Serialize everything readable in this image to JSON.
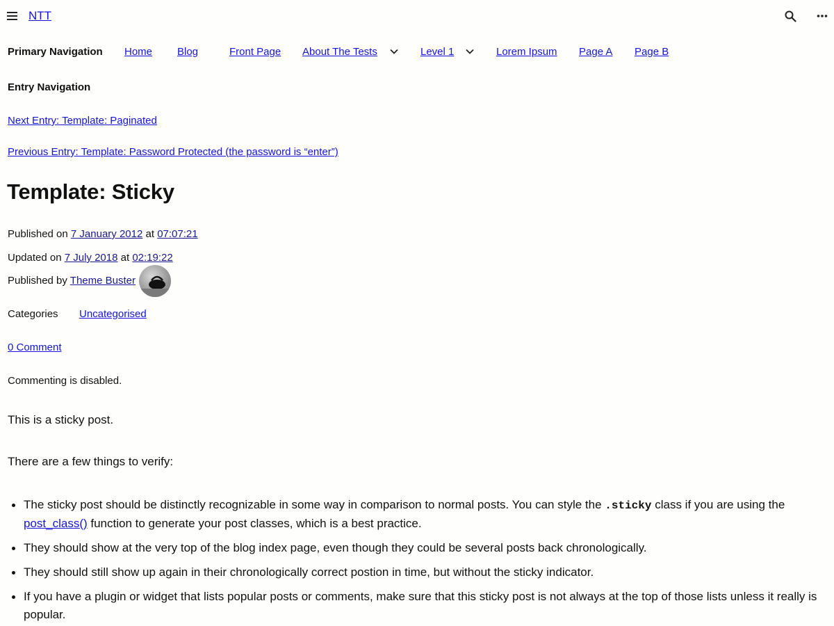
{
  "header": {
    "site_title": "NTT",
    "icons": [
      "menu-icon",
      "search-icon",
      "more-icon"
    ]
  },
  "primary_nav": {
    "heading": "Primary Navigation",
    "items": [
      {
        "label": "Home"
      },
      {
        "label": "Blog"
      },
      {
        "label": "Front Page"
      },
      {
        "label": "About The Tests",
        "has_submenu": true
      },
      {
        "label": "Level 1",
        "has_submenu": true
      },
      {
        "label": "Lorem Ipsum"
      },
      {
        "label": "Page A"
      },
      {
        "label": "Page B"
      }
    ]
  },
  "entry_nav": {
    "heading": "Entry Navigation",
    "next": "Next Entry: Template: Paginated",
    "previous": "Previous Entry: Template: Password Protected (the password is “enter”)"
  },
  "post": {
    "title": "Template: Sticky",
    "published": {
      "prefix": "Published on ",
      "date": "7 January 2012",
      "at": " at ",
      "time": "07:07:21"
    },
    "updated": {
      "prefix": "Updated on ",
      "date": "7 July 2018",
      "at": " at ",
      "time": "02:19:22"
    },
    "author": {
      "prefix": "Published by ",
      "name": "Theme Buster"
    },
    "categories_label": "Categories",
    "category": "Uncategorised",
    "comments_link": "0 Comment",
    "comment_status": "Commenting is disabled.",
    "paragraphs": [
      "This is a sticky post.",
      "There are a few things to verify:"
    ],
    "bullets": [
      {
        "part1": "The sticky post should be distinctly recognizable in some way in comparison to normal posts. You can style the ",
        "code": ".sticky",
        "part2": " class if you are using the ",
        "link": "post_class()",
        "part3": " function to generate your post classes, which is a best practice."
      },
      {
        "text": "They should show at the very top of the blog index page, even though they could be several posts back chronologically."
      },
      {
        "text": "They should still show up again in their chronologically correct postion in time, but without the sticky indicator."
      },
      {
        "text": "If you have a plugin or widget that lists popular posts or comments, make sure that this sticky post is not always at the top of those lists unless it really is popular."
      }
    ]
  },
  "colors": {
    "background": "#fefefc",
    "link": "#1515d6",
    "text": "#111111"
  }
}
